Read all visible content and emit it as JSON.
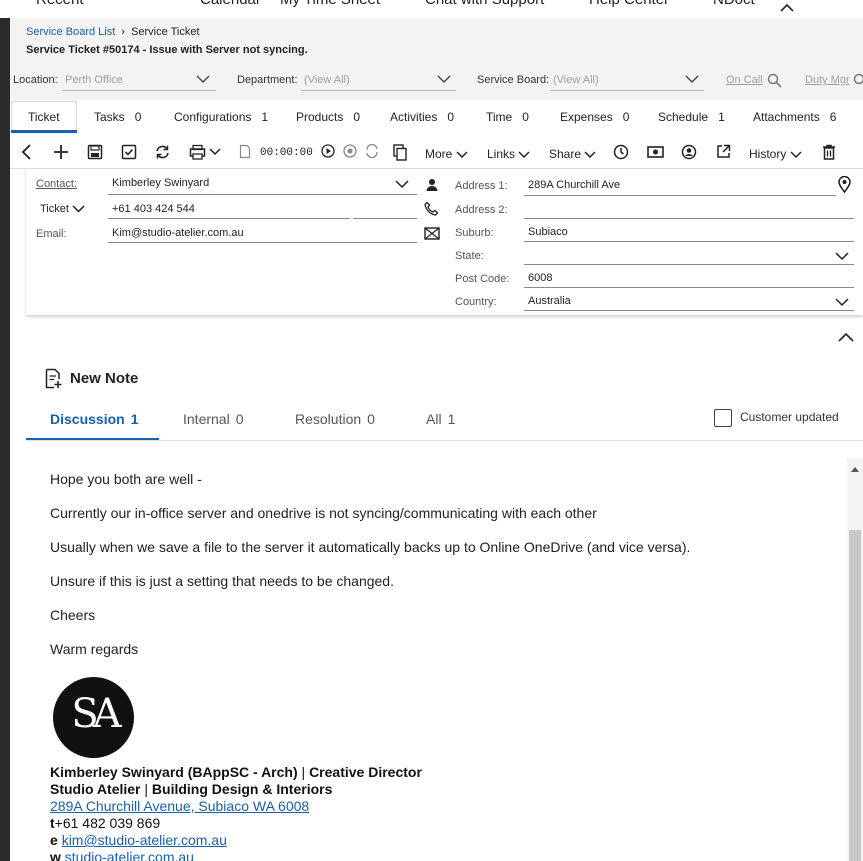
{
  "top_menu": [
    "Recent",
    "Calendar",
    "My Time Sheet",
    "Chat with Support",
    "Help Center",
    "NDoct"
  ],
  "breadcrumb": {
    "parent": "Service Board List",
    "current": "Service Ticket"
  },
  "ticket_title": "Service Ticket #50174 - Issue with Server not syncing.",
  "filters": {
    "location_label": "Location:",
    "location_value": "Perth Office",
    "department_label": "Department:",
    "department_value": "(View All)",
    "board_label": "Service Board:",
    "board_value": "(View All)",
    "on_call": "On Call",
    "duty_mgr": "Duty Mgr"
  },
  "tabs": [
    {
      "label": "Ticket",
      "count": ""
    },
    {
      "label": "Tasks",
      "count": "0"
    },
    {
      "label": "Configurations",
      "count": "1"
    },
    {
      "label": "Products",
      "count": "0"
    },
    {
      "label": "Activities",
      "count": "0"
    },
    {
      "label": "Time",
      "count": "0"
    },
    {
      "label": "Expenses",
      "count": "0"
    },
    {
      "label": "Schedule",
      "count": "1"
    },
    {
      "label": "Attachments",
      "count": "6"
    }
  ],
  "toolbar": {
    "timer": "00:00:00",
    "more": "More",
    "links": "Links",
    "share": "Share",
    "history": "History"
  },
  "contact": {
    "contact_label": "Contact:",
    "contact_value": "Kimberley Swinyard",
    "phone_type": "Ticket",
    "phone_value": "+61 403 424 544",
    "email_label": "Email:",
    "email_value": "Kim@studio-atelier.com.au"
  },
  "address": {
    "address1_label": "Address 1:",
    "address1_value": "289A Churchill Ave",
    "address2_label": "Address 2:",
    "address2_value": "",
    "suburb_label": "Suburb:",
    "suburb_value": "Subiaco",
    "state_label": "State:",
    "state_value": "",
    "postcode_label": "Post Code:",
    "postcode_value": "6008",
    "country_label": "Country:",
    "country_value": "Australia"
  },
  "notes": {
    "new_note": "New Note",
    "tabs": [
      {
        "label": "Discussion",
        "count": "1"
      },
      {
        "label": "Internal",
        "count": "0"
      },
      {
        "label": "Resolution",
        "count": "0"
      },
      {
        "label": "All",
        "count": "1"
      }
    ],
    "customer_updated": "Customer updated",
    "paragraphs": [
      "Hope you both are well -",
      "Currently our in-office server and onedrive is not syncing/communicating with each other",
      "Usually when we save a file to the server it automatically backs up to Online OneDrive (and vice versa).",
      "Unsure if this is just a setting that needs to be changed.",
      "Cheers",
      "Warm regards"
    ],
    "signature": {
      "logo_text": "SA",
      "name": "Kimberley Swinyard (BAppSC - Arch)",
      "sep": " | ",
      "role": "Creative Director",
      "company": "Studio Atelier",
      "company_tagline": "Building Design & Interiors",
      "address_link": "289A Churchill Avenue, Subiaco WA 6008",
      "phone_prefix": "t",
      "phone": "+61 482 039 869",
      "email_prefix": "e ",
      "email": "kim@studio-atelier.com.au",
      "web_prefix": "w ",
      "web": "studio-atelier.com.au"
    }
  },
  "colors": {
    "accent": "#1a5fa8",
    "header_bg": "#f3f3f3",
    "rail": "#2b2b2b"
  }
}
